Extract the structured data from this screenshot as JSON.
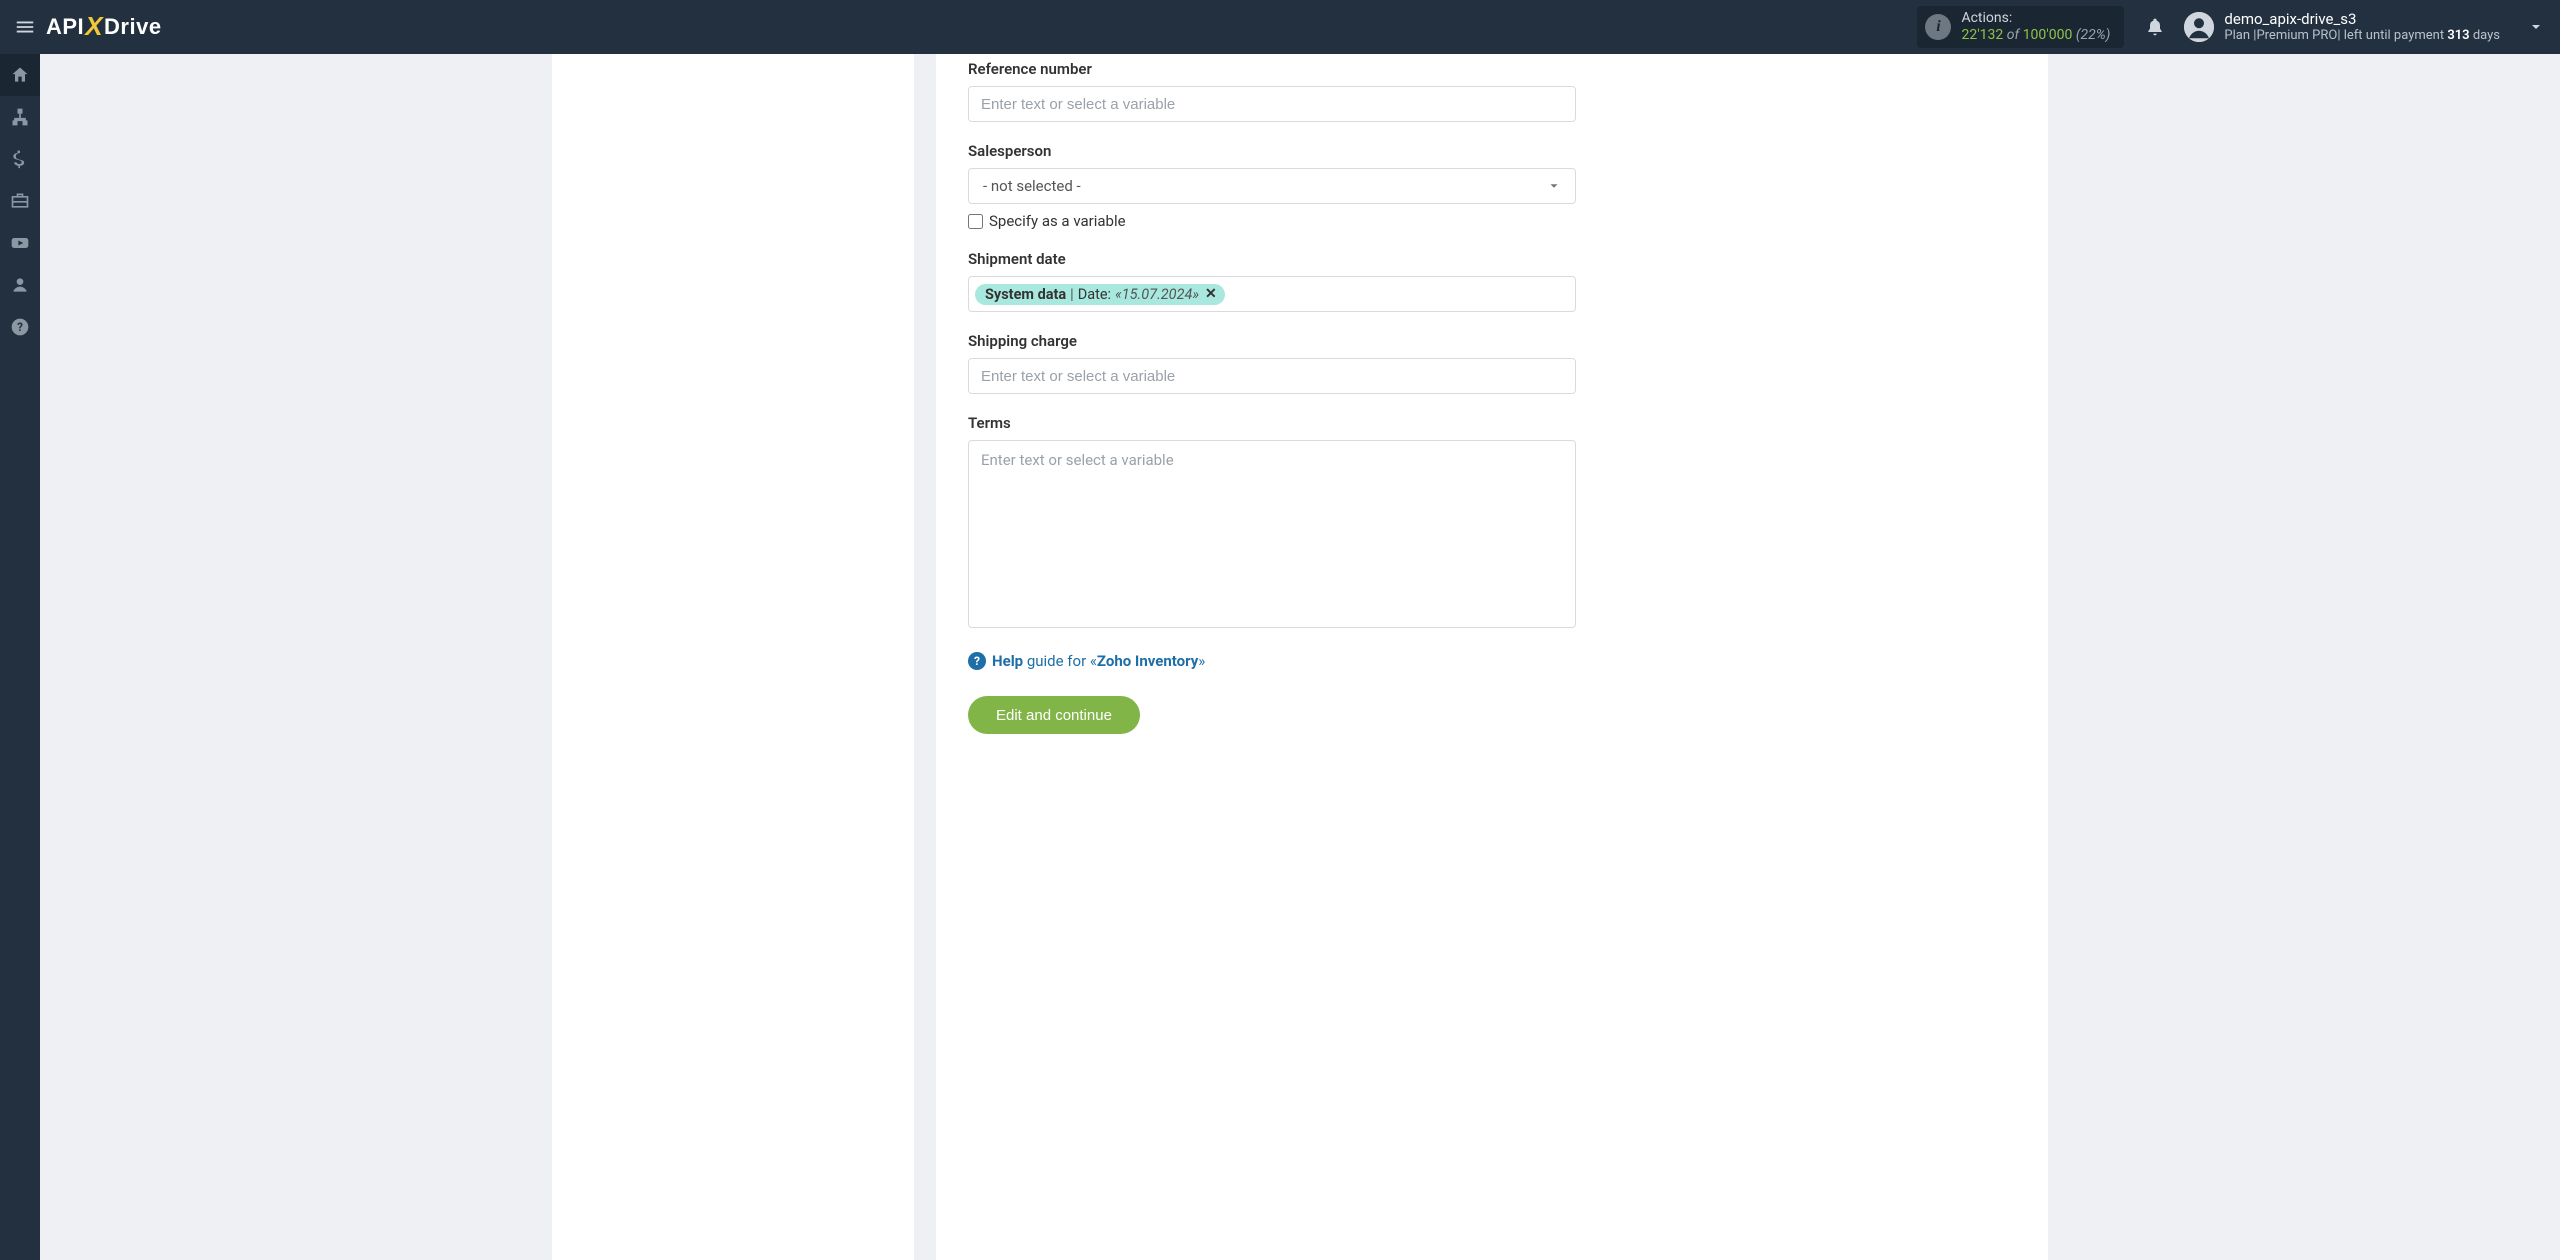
{
  "brand": {
    "part1": "API",
    "x": "X",
    "part2": "Drive"
  },
  "header": {
    "actions": {
      "label": "Actions:",
      "used": "22'132",
      "of": "of",
      "total": "100'000",
      "pct": "(22%)"
    },
    "user": {
      "name": "demo_apix-drive_s3",
      "plan_prefix": "Plan |",
      "plan_name": "Premium PRO",
      "plan_mid": "| left until payment ",
      "days_num": "313",
      "days_word": " days"
    }
  },
  "form": {
    "reference_number": {
      "label": "Reference number",
      "placeholder": "Enter text or select a variable"
    },
    "salesperson": {
      "label": "Salesperson",
      "value": "- not selected -",
      "checkbox_label": "Specify as a variable"
    },
    "shipment_date": {
      "label": "Shipment date",
      "pill_source": "System data",
      "pill_sep": " | ",
      "pill_field": "Date: ",
      "pill_value": "«15.07.2024»"
    },
    "shipping_charge": {
      "label": "Shipping charge",
      "placeholder": "Enter text or select a variable"
    },
    "terms": {
      "label": "Terms",
      "placeholder": "Enter text or select a variable"
    },
    "help": {
      "bold": "Help",
      "rest": " guide for «",
      "target": "Zoho Inventory",
      "close": "»"
    },
    "submit": "Edit and continue"
  }
}
